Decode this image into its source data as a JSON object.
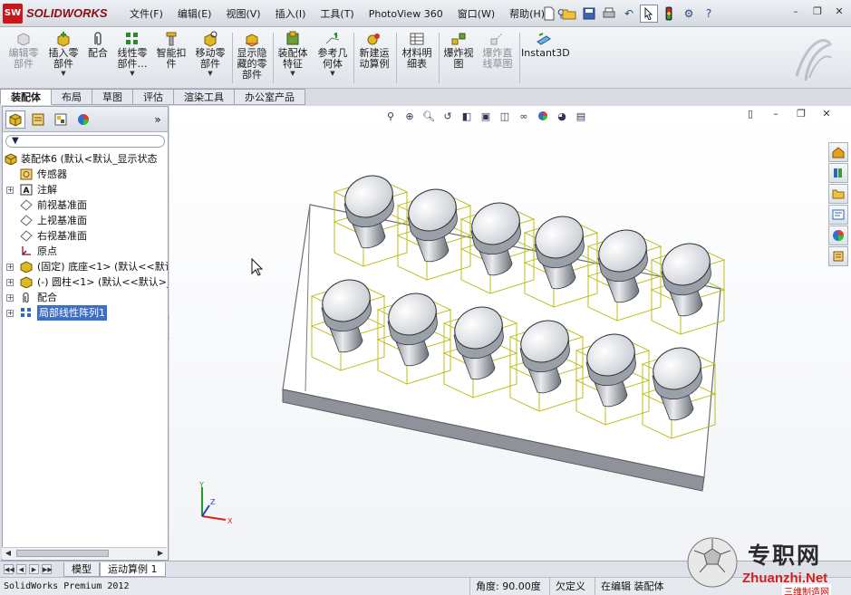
{
  "app": {
    "brand": "SOLIDWORKS",
    "brand_badge": "SW"
  },
  "menu": [
    "文件(F)",
    "编辑(E)",
    "视图(V)",
    "插入(I)",
    "工具(T)",
    "PhotoView 360",
    "窗口(W)",
    "帮助(H)"
  ],
  "commands": [
    {
      "id": "edit-component",
      "label": "编辑零\n部件",
      "disabled": true
    },
    {
      "id": "insert-component",
      "label": "插入零\n部件",
      "disabled": false
    },
    {
      "id": "mate",
      "label": "配合",
      "disabled": false
    },
    {
      "id": "linear-pattern",
      "label": "线性零\n部件…",
      "disabled": false
    },
    {
      "id": "smart-fastener",
      "label": "智能扣\n件",
      "disabled": false
    },
    {
      "id": "move-component",
      "label": "移动零\n部件",
      "disabled": false
    },
    {
      "id": "show-hidden",
      "label": "显示隐\n藏的零\n部件",
      "disabled": false
    },
    {
      "id": "assembly-feature",
      "label": "装配体\n特征",
      "disabled": false
    },
    {
      "id": "ref-geometry",
      "label": "参考几\n何体",
      "disabled": false
    },
    {
      "id": "new-motion-study",
      "label": "新建运\n动算例",
      "disabled": false
    },
    {
      "id": "bom",
      "label": "材料明\n细表",
      "disabled": false
    },
    {
      "id": "exploded-view",
      "label": "爆炸视\n图",
      "disabled": false
    },
    {
      "id": "explode-line",
      "label": "爆炸直\n线草图",
      "disabled": true
    },
    {
      "id": "instant3d",
      "label": "Instant3D",
      "disabled": false
    }
  ],
  "tabs": [
    "装配体",
    "布局",
    "草图",
    "评估",
    "渲染工具",
    "办公室产品"
  ],
  "tree": [
    {
      "label": "装配体6  (默认<默认_显示状态",
      "icon": "assembly-icon",
      "expand": "",
      "level": 0
    },
    {
      "label": "传感器",
      "icon": "sensor-icon",
      "expand": "",
      "level": 1
    },
    {
      "label": "注解",
      "icon": "annotation-icon",
      "expand": "+",
      "level": 1
    },
    {
      "label": "前视基准面",
      "icon": "plane-icon",
      "expand": "",
      "level": 1
    },
    {
      "label": "上视基准面",
      "icon": "plane-icon",
      "expand": "",
      "level": 1
    },
    {
      "label": "右视基准面",
      "icon": "plane-icon",
      "expand": "",
      "level": 1
    },
    {
      "label": "原点",
      "icon": "origin-icon",
      "expand": "",
      "level": 1
    },
    {
      "label": "(固定) 底座<1> (默认<<默认",
      "icon": "part-icon",
      "expand": "+",
      "level": 1
    },
    {
      "label": "(-) 圆柱<1> (默认<<默认>_",
      "icon": "part-icon",
      "expand": "+",
      "level": 1
    },
    {
      "label": "配合",
      "icon": "mate-icon",
      "expand": "+",
      "level": 1
    },
    {
      "label": "局部线性阵列1",
      "icon": "pattern-icon",
      "expand": "+",
      "level": 1,
      "selected": true
    }
  ],
  "sheet_tabs": [
    "模型",
    "运动算例 1"
  ],
  "status": {
    "app_name": "SolidWorks Premium 2012",
    "angle": "角度: 90.00度",
    "definition": "欠定义",
    "editing": "在编辑 装配体"
  },
  "triad": {
    "x": "X",
    "y": "Y",
    "z": "Z"
  },
  "watermark": {
    "cn": "专职网",
    "url": "Zhuanzhi.Net",
    "tag": "三维制造网"
  },
  "colors": {
    "accent": "#3c6fc5",
    "brand": "#c8161d",
    "wire": "#b8b800"
  }
}
